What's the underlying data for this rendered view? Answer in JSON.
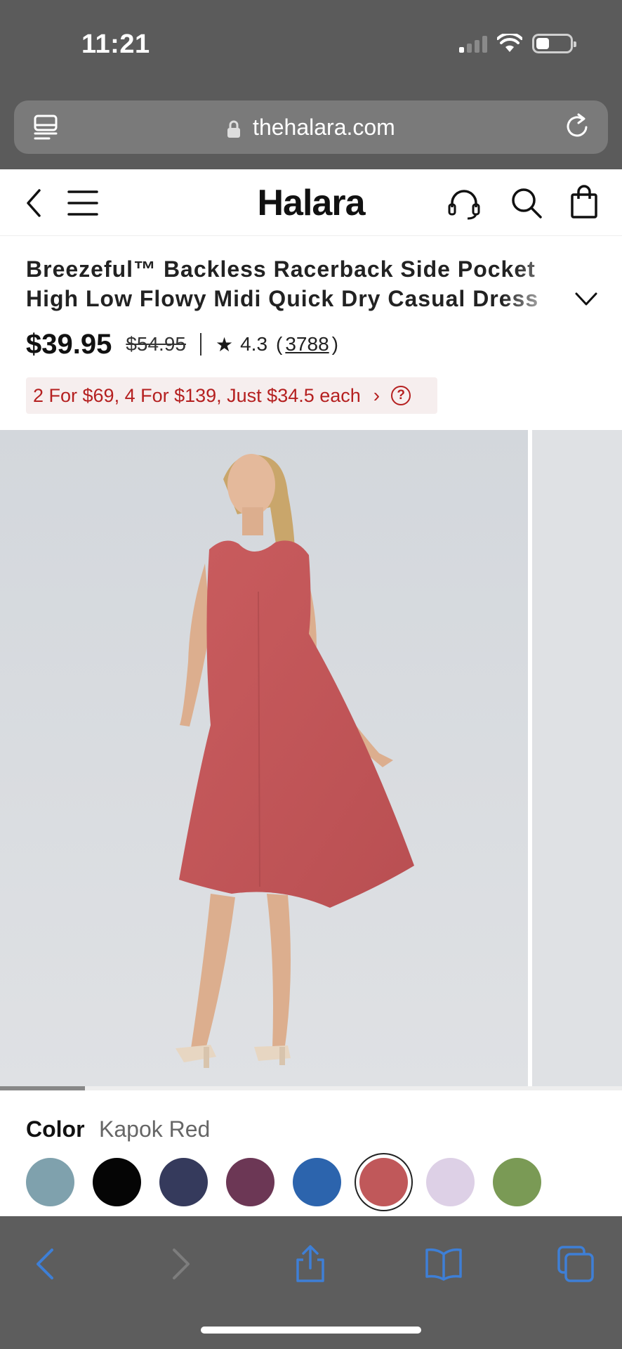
{
  "status_bar": {
    "time": "11:21"
  },
  "url_bar": {
    "domain": "thehalara.com"
  },
  "header": {
    "logo": "Halara"
  },
  "product": {
    "title_line1": "Breezeful™ Backless Racerback Side Pocket",
    "title_line2": "High Low Flowy Midi Quick Dry Casual Dress",
    "price": "$39.95",
    "old_price": "$54.95",
    "rating": "4.3",
    "review_open": "(",
    "review_count": "3788",
    "review_close": ")",
    "promo": "2 For $69, 4 For $139, Just $34.5 each",
    "gallery_progress": 0.137
  },
  "color": {
    "label": "Color",
    "selected": "Kapok Red",
    "swatches": [
      {
        "hex": "#7fa1ad"
      },
      {
        "hex": "#050505"
      },
      {
        "hex": "#353a5c"
      },
      {
        "hex": "#6c3755"
      },
      {
        "hex": "#2c64ad"
      },
      {
        "hex": "#c0585a",
        "selected": true
      },
      {
        "hex": "#ddd0e6"
      },
      {
        "hex": "#7a9a55"
      }
    ]
  },
  "icons": {
    "header": [
      "back-icon",
      "menu-icon",
      "support-headset-icon",
      "search-icon",
      "shopping-bag-icon"
    ],
    "toolbar": [
      "back-arrow-icon",
      "forward-arrow-icon",
      "share-icon",
      "bookmarks-icon",
      "tabs-icon"
    ]
  },
  "colors": {
    "promo_text": "#b52020",
    "toolbar_accent": "#3e7fd6"
  }
}
